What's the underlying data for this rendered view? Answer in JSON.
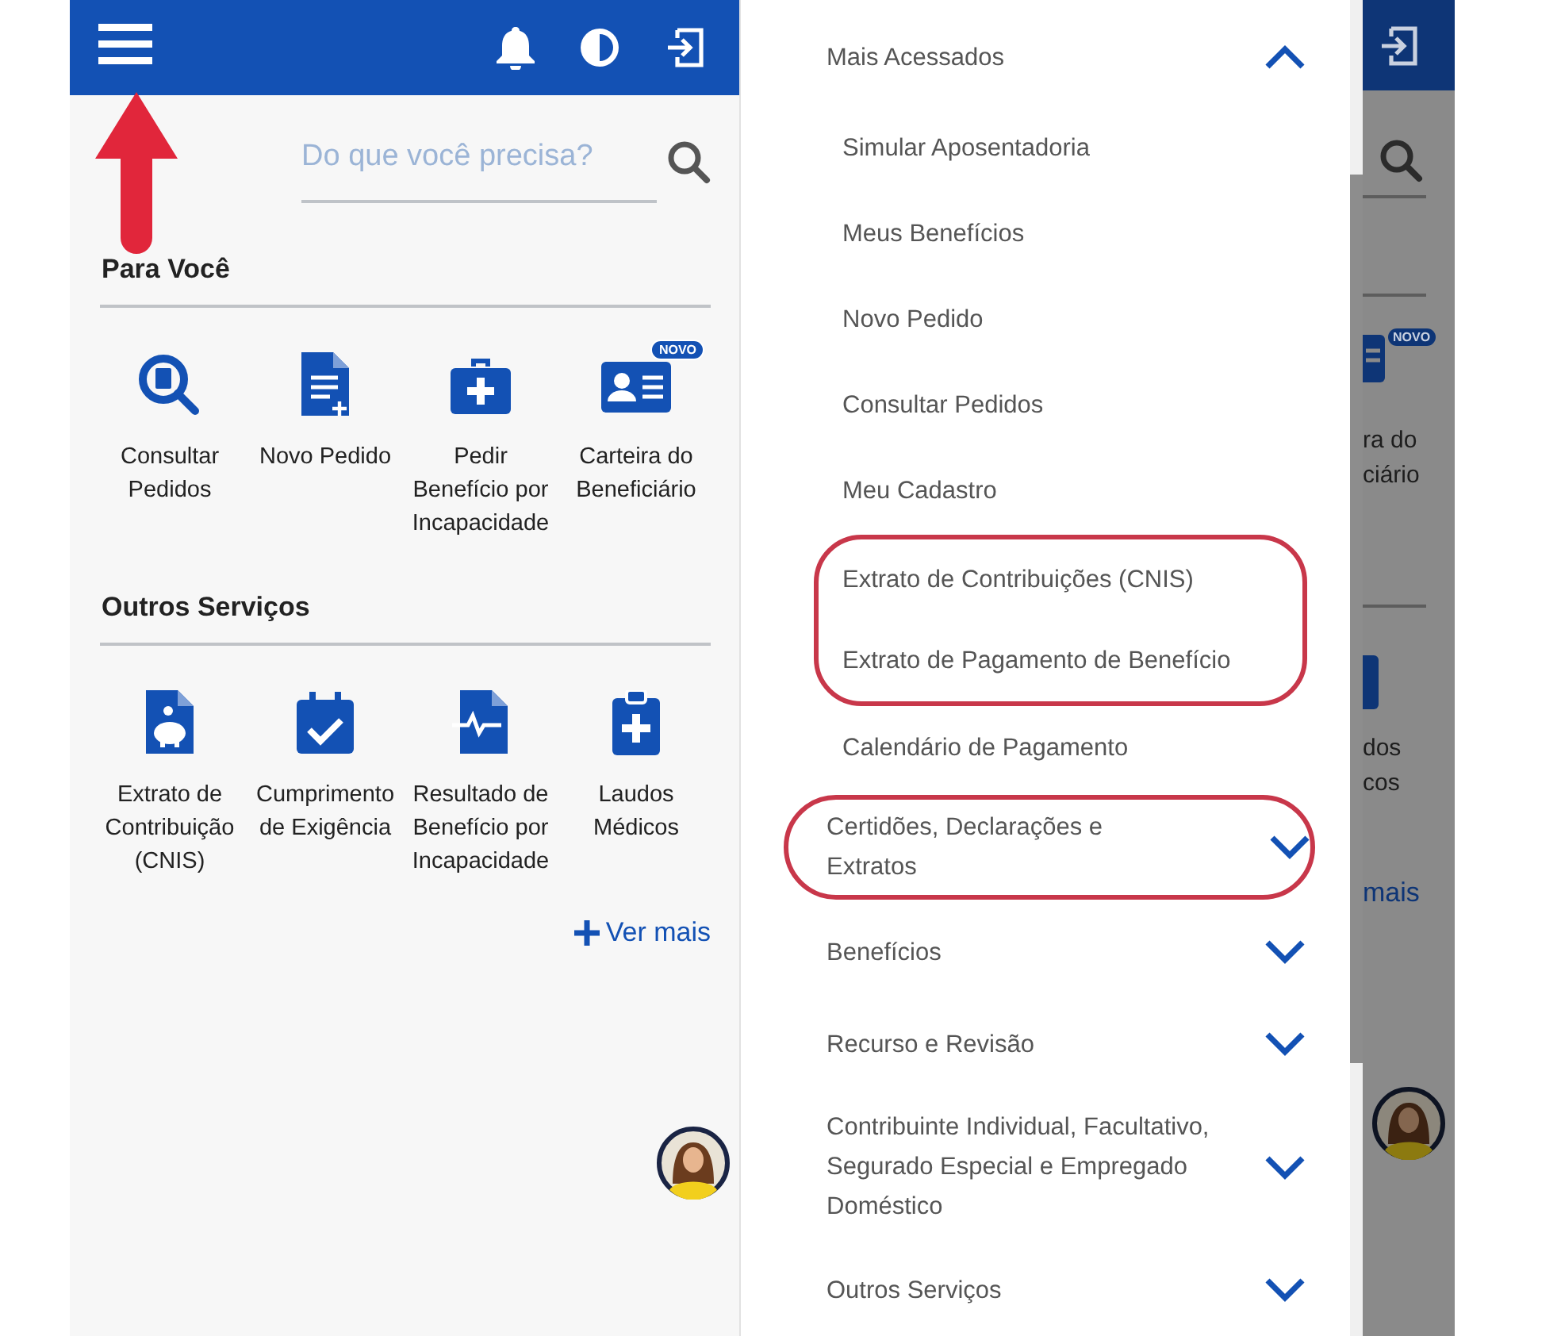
{
  "home": {
    "search": {
      "placeholder": "Do que você precisa?"
    },
    "sections": [
      {
        "title": "Para Você",
        "services": [
          {
            "label": "Consultar Pedidos"
          },
          {
            "label": "Novo Pedido"
          },
          {
            "label": "Pedir Benefício por Incapacidade"
          },
          {
            "label": "Carteira do Beneficiário",
            "badge": "NOVO"
          }
        ]
      },
      {
        "title": "Outros Serviços",
        "services": [
          {
            "label": "Extrato de Contribuição (CNIS)"
          },
          {
            "label": "Cumprimento de Exigência"
          },
          {
            "label": "Resultado de Benefício por Incapacidade"
          },
          {
            "label": "Laudos Médicos"
          }
        ]
      }
    ],
    "more_link": "Ver mais"
  },
  "menu": {
    "groups": [
      {
        "title": "Mais Acessados",
        "expanded": true,
        "highlighted": false,
        "items": [
          {
            "label": "Simular Aposentadoria",
            "highlighted": false
          },
          {
            "label": "Meus Benefícios",
            "highlighted": false
          },
          {
            "label": "Novo Pedido",
            "highlighted": false
          },
          {
            "label": "Consultar Pedidos",
            "highlighted": false
          },
          {
            "label": "Meu Cadastro",
            "highlighted": false
          },
          {
            "label": "Extrato de Contribuições (CNIS)",
            "highlighted": true
          },
          {
            "label": "Extrato de Pagamento de Benefício",
            "highlighted": true
          },
          {
            "label": "Calendário de Pagamento",
            "highlighted": false
          }
        ]
      },
      {
        "title": "Certidões, Declarações e Extratos",
        "expanded": false,
        "highlighted": true
      },
      {
        "title": "Benefícios",
        "expanded": false,
        "highlighted": false
      },
      {
        "title": "Recurso e Revisão",
        "expanded": false,
        "highlighted": false
      },
      {
        "title": "Contribuinte Individual, Facultativo, Segurado Especial e Empregado Doméstico",
        "expanded": false,
        "highlighted": false
      },
      {
        "title": "Outros Serviços",
        "expanded": false,
        "highlighted": false
      }
    ]
  },
  "background_peek": {
    "badge": "NOVO",
    "card_label": [
      "ra do",
      "ciário"
    ],
    "service_label": [
      "dos",
      "cos"
    ],
    "link": "mais"
  }
}
